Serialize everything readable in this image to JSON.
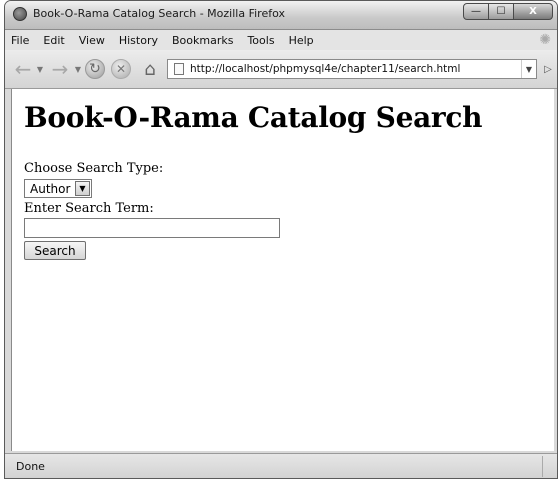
{
  "window": {
    "title": "Book-O-Rama Catalog Search - Mozilla Firefox",
    "controls": {
      "minimize": "—",
      "maximize": "☐",
      "close": "X"
    }
  },
  "menubar": {
    "items": [
      {
        "label": "File"
      },
      {
        "label": "Edit"
      },
      {
        "label": "View"
      },
      {
        "label": "History"
      },
      {
        "label": "Bookmarks"
      },
      {
        "label": "Tools"
      },
      {
        "label": "Help"
      }
    ]
  },
  "navbar": {
    "icons": {
      "back": "←",
      "forward": "→",
      "reload": "↻",
      "stop": "✕",
      "home": "⌂",
      "go": "▷"
    },
    "url": "http://localhost/phpmysql4e/chapter11/search.html"
  },
  "page": {
    "heading": "Book-O-Rama Catalog Search",
    "search_type_label": "Choose Search Type:",
    "search_type_value": "Author",
    "search_term_label": "Enter Search Term:",
    "search_term_value": "",
    "search_button": "Search"
  },
  "statusbar": {
    "text": "Done"
  }
}
